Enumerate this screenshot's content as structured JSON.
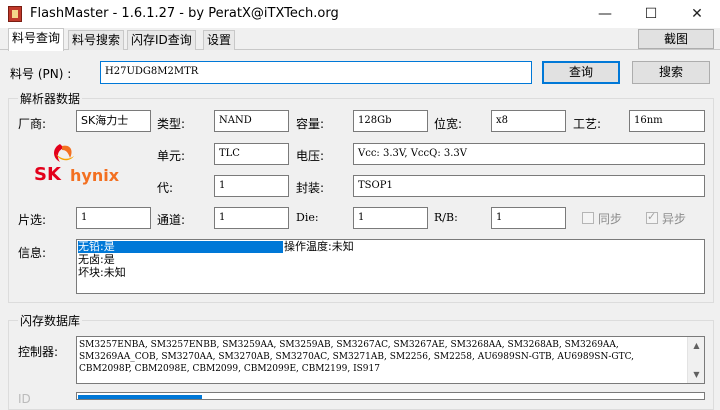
{
  "window": {
    "title": "FlashMaster - 1.6.1.27 - by PeratX@iTXTech.org",
    "minimize": "—",
    "maximize": "☐",
    "close": "✕"
  },
  "tabs": [
    {
      "label": "料号查询"
    },
    {
      "label": "料号搜索"
    },
    {
      "label": "闪存ID查询"
    },
    {
      "label": "设置"
    }
  ],
  "screenshot_button": "截图",
  "query": {
    "pn_label": "料号 (PN) :",
    "pn_value": "H27UDG8M2MTR",
    "query_button": "查询",
    "search_button": "搜索"
  },
  "parser": {
    "title": "解析器数据",
    "vendor_label": "厂商:",
    "vendor_value": "SK海力士",
    "logo_text_sk": "SK",
    "logo_text_hynix": "hynix",
    "type_label": "类型:",
    "type_value": "NAND",
    "capacity_label": "容量:",
    "capacity_value": "128Gb",
    "width_label": "位宽:",
    "width_value": "x8",
    "process_label": "工艺:",
    "process_value": "16nm",
    "cell_label": "单元:",
    "cell_value": "TLC",
    "voltage_label": "电压:",
    "voltage_value": "Vcc: 3.3V, VccQ: 3.3V",
    "gen_label": "代:",
    "gen_value": "1",
    "package_label": "封装:",
    "package_value": "TSOP1",
    "ce_label": "片选:",
    "ce_value": "1",
    "channel_label": "通道:",
    "channel_value": "1",
    "die_label": "Die:",
    "die_value": "1",
    "rb_label": "R/B:",
    "rb_value": "1",
    "sync_label": "同步",
    "sync_checked": false,
    "async_label": "异步",
    "async_checked": true,
    "info_label": "信息:",
    "info_lines": [
      "无铅:是",
      "无卤:是",
      "坏块:未知"
    ],
    "temp_text": "操作温度:未知"
  },
  "database": {
    "title": "闪存数据库",
    "controller_label": "控制器:",
    "controller_lines": [
      "SM3257ENBA, SM3257ENBB, SM3259AA, SM3259AB, SM3267AC, SM3267AE, SM3268AA, SM3268AB, SM3269AA,",
      "SM3269AA_COB, SM3270AA, SM3270AB, SM3270AC, SM3271AB, SM2256, SM2258, AU6989SN-GTB, AU6989SN-GTC,",
      "CBM2098P, CBM2098E, CBM2099, CBM2099E, CBM2199, IS917"
    ],
    "next_label_partial": "ID"
  },
  "colors": {
    "accent": "#0078d7",
    "selection": "#0078d7",
    "sk_red": "#e3001b",
    "hynix_orange": "#f37021"
  }
}
